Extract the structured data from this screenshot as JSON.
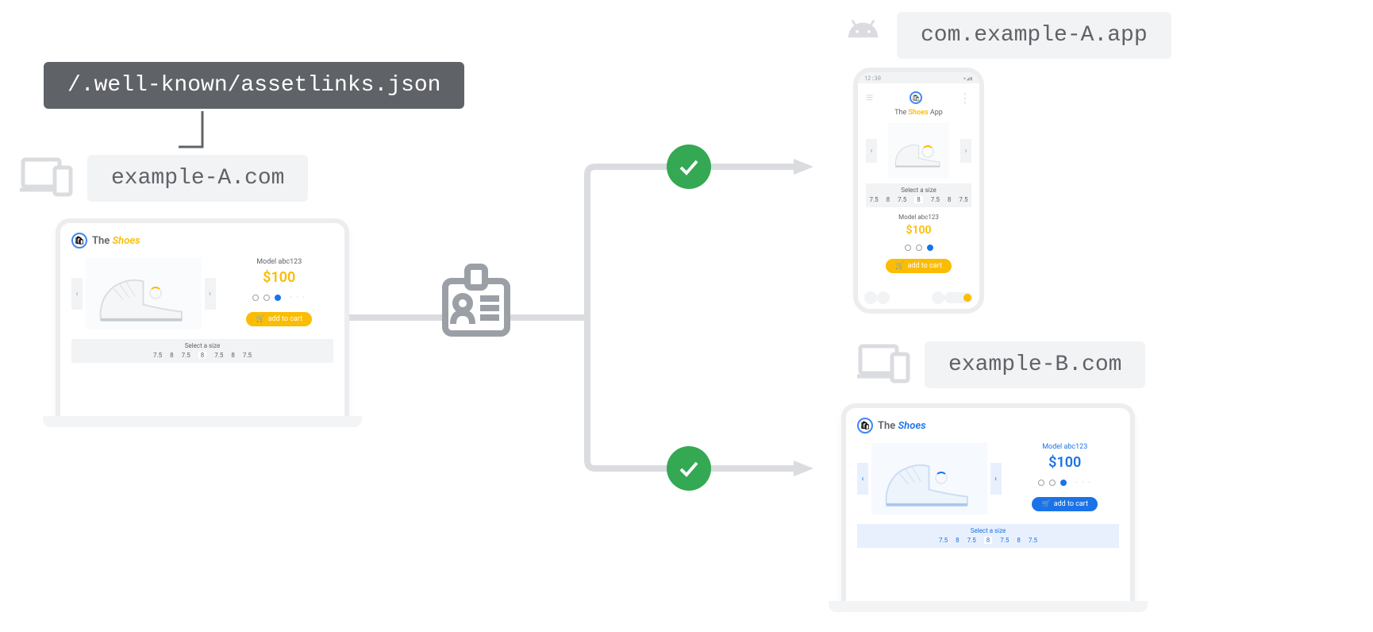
{
  "assetlinks_path": "/.well-known/assetlinks.json",
  "domain_a": "example-A.com",
  "domain_b": "example-B.com",
  "android_package": "com.example-A.app",
  "shop": {
    "brand_prefix": "The",
    "brand_word": "Shoes",
    "app_suffix": "App",
    "model": "Model abc123",
    "price": "$100",
    "add_to_cart": "add to cart",
    "select_size": "Select a size",
    "sizes": [
      "7.5",
      "8",
      "7.5",
      "8",
      "7.5",
      "8",
      "7.5"
    ],
    "selected_size_index": 3
  },
  "phone_time": "12:30"
}
